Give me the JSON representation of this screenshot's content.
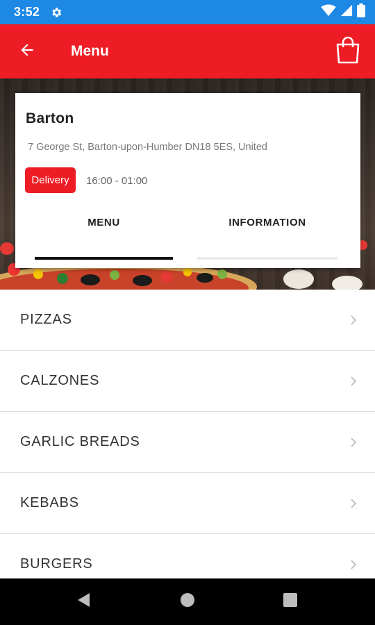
{
  "status_bar": {
    "time": "3:52",
    "icons": [
      "gear-icon",
      "wifi-icon",
      "signal-icon",
      "battery-icon"
    ],
    "color": "#1e88e5"
  },
  "app_bar": {
    "title": "Menu",
    "color": "#ee1c24",
    "icons": [
      "arrow-back-icon",
      "shopping-bag-icon"
    ]
  },
  "store": {
    "name": "Barton",
    "address": "7 George St, Barton-upon-Humber DN18 5ES, United",
    "service_badge": "Delivery",
    "hours": "16:00 - 01:00"
  },
  "tabs": [
    {
      "label": "MENU",
      "active": true
    },
    {
      "label": "INFORMATION",
      "active": false
    }
  ],
  "categories": [
    {
      "label": "PIZZAS"
    },
    {
      "label": "CALZONES"
    },
    {
      "label": "GARLIC BREADS"
    },
    {
      "label": "KEBABS"
    },
    {
      "label": "BURGERS"
    }
  ],
  "nav_bar": {
    "icons": [
      "back-triangle-icon",
      "home-circle-icon",
      "recents-square-icon"
    ]
  }
}
